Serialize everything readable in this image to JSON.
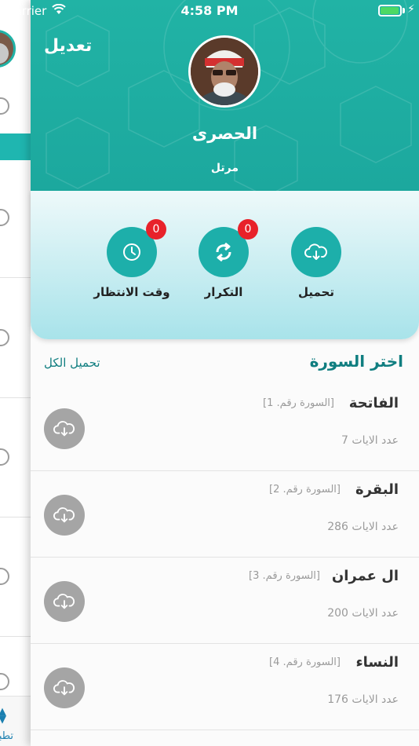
{
  "status_bar": {
    "carrier": "Carrier",
    "time": "4:58 PM",
    "battery_level": 0.95
  },
  "header": {
    "edit_label": "تعديل",
    "reciter_name": "الحصرى",
    "reciter_style": "مرتل"
  },
  "actions": [
    {
      "label": "تحميل",
      "icon": "cloud-download-icon"
    },
    {
      "label": "التكرار",
      "icon": "repeat-icon",
      "badge": "0"
    },
    {
      "label": "وقت الانتظار",
      "icon": "clock-icon",
      "badge": "0"
    }
  ],
  "list": {
    "title": "اختر السورة",
    "download_all": "تحميل الكل",
    "surahs": [
      {
        "name": "الفاتحة",
        "number": "[السورة رقم. 1]",
        "ayat": "عدد الايات 7"
      },
      {
        "name": "البقرة",
        "number": "[السورة رقم. 2]",
        "ayat": "عدد الايات 286"
      },
      {
        "name": "ال عمران",
        "number": "[السورة رقم. 3]",
        "ayat": "عدد الايات 200"
      },
      {
        "name": "النساء",
        "number": "[السورة رقم. 4]",
        "ayat": "عدد الايات 176"
      }
    ]
  },
  "side_tab": {
    "label": "تطبي"
  },
  "colors": {
    "teal": "#1fb3a5",
    "badge": "#e8222a",
    "title": "#107e80",
    "download_gray": "#a5a5a5"
  }
}
